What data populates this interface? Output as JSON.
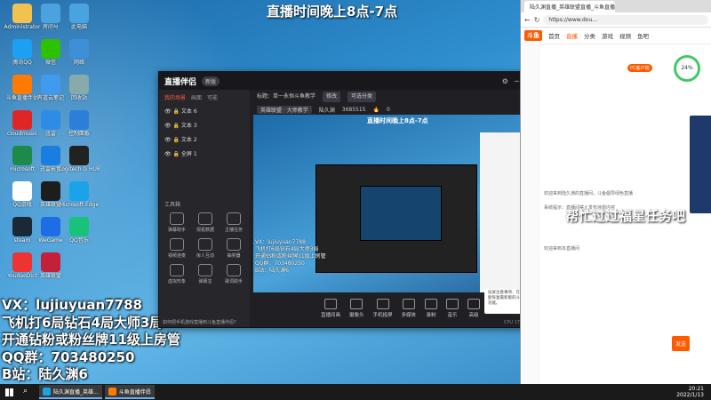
{
  "overlay": {
    "top_title": "直播时间晚上8点-7点",
    "lines": [
      "VX：lujiuyuan7788",
      "飞机打6局钻石4局大师3局",
      "开通钻粉或粉丝牌11级上房管",
      "QQ群：703480250",
      "B站：陆久渊6"
    ],
    "fuli": "帮忙过过福星任务吧"
  },
  "desktop_icons": [
    {
      "label": "Administrator",
      "color": "#f2c14e"
    },
    {
      "label": "房间号",
      "color": "#4aa3df"
    },
    {
      "label": "此电脑",
      "color": "#4aa3df"
    },
    {
      "label": "腾讯QQ",
      "color": "#1ea0f2"
    },
    {
      "label": "微信",
      "color": "#2dc100"
    },
    {
      "label": "网络",
      "color": "#3d8fd8"
    },
    {
      "label": "斗鱼直播伴侣",
      "color": "#ff7a00"
    },
    {
      "label": "有道云笔记",
      "color": "#3f9af0"
    },
    {
      "label": "回收站",
      "color": "#8aa"
    },
    {
      "label": "cloudmusic",
      "color": "#e02525"
    },
    {
      "label": "迅雷",
      "color": "#2f8ce6"
    },
    {
      "label": "控制面板",
      "color": "#2b7fd8"
    },
    {
      "label": "microsoft",
      "color": "#1e8a4a"
    },
    {
      "label": "迅雷影音",
      "color": "#1a7ee0"
    },
    {
      "label": "Logitech G HUB",
      "color": "#222"
    },
    {
      "label": "QQ游戏",
      "color": "#fff"
    },
    {
      "label": "英雄联盟",
      "color": "#1d1d1d"
    },
    {
      "label": "Microsoft Edge",
      "color": "#1aa3e8"
    },
    {
      "label": "steam",
      "color": "#1b2838"
    },
    {
      "label": "WeGame",
      "color": "#1e6de6"
    },
    {
      "label": "QQ音乐",
      "color": "#19c27a"
    },
    {
      "label": "YoudaoDict",
      "color": "#e33"
    },
    {
      "label": "英雄联盟",
      "color": "#c5203a"
    }
  ],
  "app": {
    "logo": "直播伴侣",
    "version": "新版",
    "tabs": [
      "我的场景",
      "画面",
      "可能"
    ],
    "scenes": [
      "文本 6",
      "文本 3",
      "文本 2",
      "全屏 1"
    ],
    "header": [
      "标题：单一永恒斗鱼教学",
      "修改",
      "可选分类"
    ],
    "header2": [
      "英雄联盟 · 大师教学",
      "陆久渊",
      "3685515",
      "0"
    ],
    "tools_title": "工具箱",
    "tools": [
      "弹幕助手",
      "观看数据",
      "主播任务",
      "视频连麦",
      "房人互动",
      "抽奖器",
      "虚拟形象",
      "弹幕宝",
      "歌词助手"
    ],
    "notice": "如何把手机游戏直播到斗鱼直播伴侣?",
    "preview_title": "直播时间晚上8点-7点",
    "preview_lines": [
      "VX：lujiuyuan7788",
      "飞机打6局钻石4局大师3局",
      "开通钻粉或粉丝牌11级上房管",
      "QQ群：703480250",
      "B站：陆久渊6"
    ],
    "tip": "投屏注意事项：在升级前使用之间可以做了，如果能恢复最新版的斗鱼直播伴侣，就能使用多屏互动功能。",
    "bottom": [
      "直播间画",
      "摄像头",
      "手机投屏",
      "多媒体",
      "录制",
      "音乐",
      "高级"
    ],
    "status": "CPU 17% 内存 38%"
  },
  "browser": {
    "tab": "陆久渊直播_英雄联盟直播_斗鱼直播",
    "url": "https://www.dou...",
    "nav": [
      "首页",
      "直播",
      "分类",
      "游戏",
      "视频",
      "鱼吧"
    ],
    "gauge": "24%",
    "pc_label": "PC客户端",
    "chat": [
      "欢迎来到陆久渊的直播间，斗鱼倡导绿色直播",
      "系统提示：直播间禁止发布违规内容",
      "欢迎来到本直播间"
    ],
    "send": "发送"
  },
  "taskbar": {
    "items": [
      "陆久渊直播_英雄...",
      "斗鱼直播伴侣"
    ],
    "time": "20:21",
    "date": "2022/1/13"
  }
}
